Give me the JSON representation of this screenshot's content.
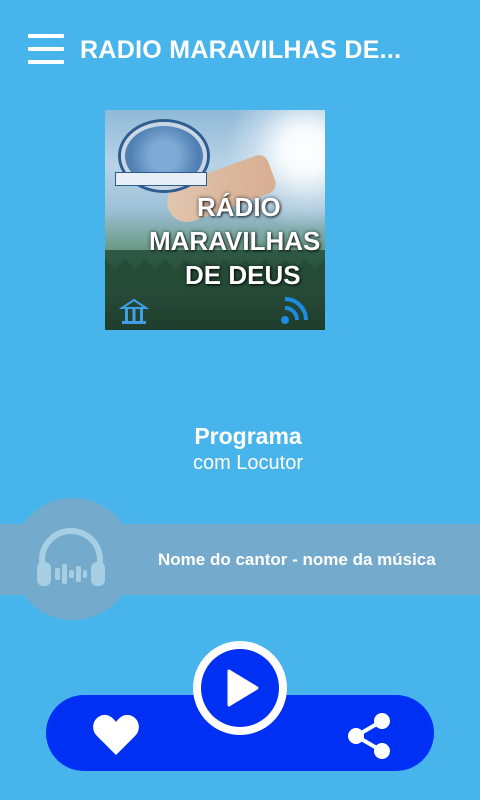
{
  "header": {
    "title": "RADIO MARAVILHAS DE...",
    "menu_icon": "hamburger-menu-icon"
  },
  "cover": {
    "line1": "RÁDIO",
    "line2": "MARAVILHAS",
    "line3": "DE DEUS",
    "seal_icon": "church-seal-logo",
    "wifi_icon": "broadcast-wifi-icon"
  },
  "program": {
    "title": "Programa",
    "host": "com Locutor"
  },
  "now_playing": {
    "text": "Nome do cantor - nome da música",
    "icon": "headphones-icon"
  },
  "controls": {
    "like_icon": "heart-icon",
    "play_icon": "play-icon",
    "share_icon": "share-icon"
  },
  "colors": {
    "background": "#48b4ec",
    "band": "#74aacb",
    "control_bar": "#0130f5",
    "text": "#ffffff"
  }
}
